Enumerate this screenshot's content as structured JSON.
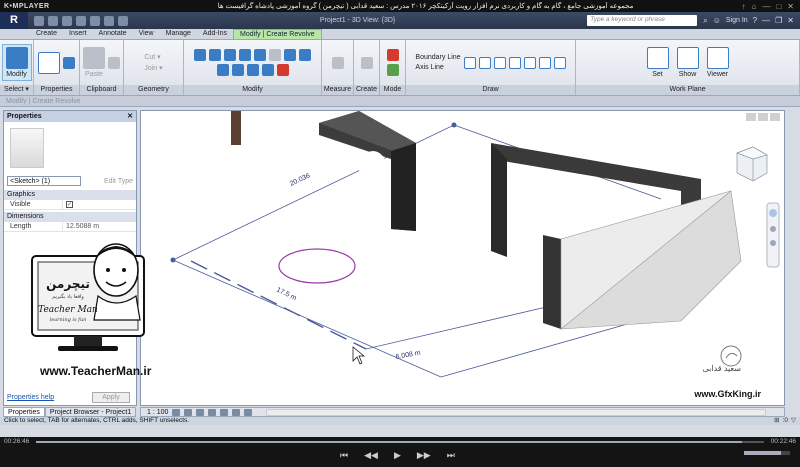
{
  "player": {
    "logo": "K•MPLAYER",
    "title": "مجموعه آموزشی جامع ، گام به گام و کاربردی نرم افزار رویت آرکیتکچر ۲۰۱۶ مدرس : سعید قدابی ( تیچرمن ) گروه آموزشی پادشاه گرافیست ها",
    "window_buttons": [
      "↑",
      "⌂",
      "—",
      "□",
      "✕"
    ],
    "elapsed": "00:26:46",
    "total": "00:22:46",
    "progress": 0.97,
    "volume": 0.8,
    "controls": [
      "⏮",
      "◀◀",
      "▶",
      "▶▶",
      "⏭"
    ]
  },
  "revit": {
    "logo": "R",
    "doc_title": "Project1 - 3D View: {3D}",
    "search_placeholder": "Type a keyword or phrase",
    "sign_in": "Sign In",
    "tabs": [
      "Create",
      "Insert",
      "Annotate",
      "View",
      "Manage",
      "Add-Ins",
      "Modify | Create Revolve"
    ],
    "active_tab": "Modify | Create Revolve",
    "panels": {
      "select": "Select ▾",
      "modify_label": "Modify",
      "properties": "Properties",
      "clipboard": "Clipboard",
      "paste_label": "Paste",
      "cut_label": "Cut ▾",
      "join_label": "Join ▾",
      "geometry": "Geometry",
      "modify": "Modify",
      "measure": "Measure",
      "create": "Create",
      "mode": "Mode",
      "draw": "Draw",
      "boundary_line": "Boundary Line",
      "axis_line": "Axis Line",
      "work_plane": "Work Plane",
      "set": "Set",
      "show": "Show",
      "viewer": "Viewer"
    },
    "options_bar": "Modify | Create Revolve"
  },
  "properties_panel": {
    "title": "Properties",
    "close": "✕",
    "type_selector": "<Sketch> (1)",
    "edit_type": "Edit Type",
    "groups": [
      {
        "name": "Graphics",
        "rows": [
          {
            "key": "Visible",
            "value": "✓"
          }
        ]
      },
      {
        "name": "Dimensions",
        "rows": [
          {
            "key": "Length",
            "value": "12.5088 m"
          }
        ]
      }
    ],
    "help_link": "Properties help",
    "apply": "Apply",
    "bottom_tabs": [
      "Properties",
      "Project Browser - Project1"
    ]
  },
  "teacher_man": {
    "logo_fa": "تیچرمن",
    "tagline_fa": "واقعا یاد بگیریم",
    "name": "Teacher Man",
    "sub": "learning is fun",
    "url": "www.TeacherMan.ir"
  },
  "watermark": {
    "name_fa": "سعید قدابی",
    "url": "www.GfxKing.ir"
  },
  "viewport": {
    "dim_left": "20.036",
    "dim_center": "17.5 m",
    "dim_right": "6.008 m"
  },
  "view_bar": {
    "scale": "1 : 100"
  },
  "status_bar": {
    "message": "Click to select, TAB for alternates, CTRL adds, SHIFT unselects.",
    "right_value": ":0"
  }
}
